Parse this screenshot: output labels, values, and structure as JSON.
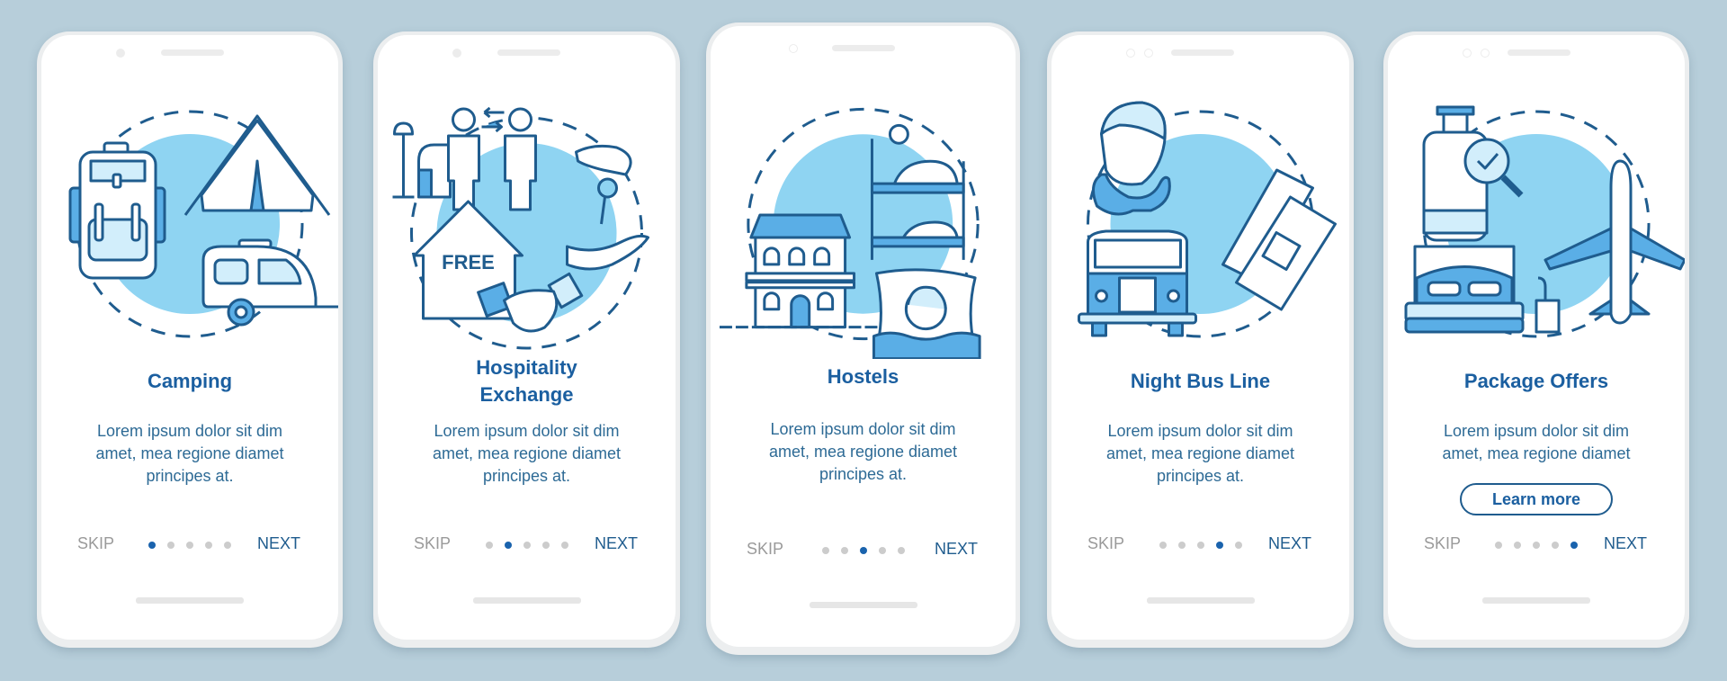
{
  "colors": {
    "background": "#b7ceda",
    "accent_dark": "#1b5fa0",
    "accent_light": "#8fd4f2",
    "dot_active": "#1a63ad",
    "dot_inactive": "#cccccc",
    "skip_text": "#9a9a9a"
  },
  "screens": [
    {
      "title": "Camping",
      "description": "Lorem ipsum dolor sit dim amet, mea regione diamet principes at.",
      "illustration": [
        "backpack-icon",
        "tent-icon",
        "camper-trailer-icon"
      ],
      "skip_label": "SKIP",
      "next_label": "NEXT",
      "page_index": 1,
      "page_count": 5
    },
    {
      "title": "Hospitality Exchange",
      "description": "Lorem ipsum dolor sit dim amet, mea regione diamet principes at.",
      "illustration": [
        "people-exchange-icon",
        "armchair-lamp-icon",
        "key-handover-icon",
        "free-house-icon",
        "handshake-icon"
      ],
      "illustration_text": "FREE",
      "skip_label": "SKIP",
      "next_label": "NEXT",
      "page_index": 2,
      "page_count": 5
    },
    {
      "title": "Hostels",
      "description": "Lorem ipsum dolor sit dim amet, mea regione diamet principes at.",
      "illustration": [
        "hostel-building-icon",
        "bunk-bed-icon",
        "sleeping-woman-icon"
      ],
      "skip_label": "SKIP",
      "next_label": "NEXT",
      "page_index": 3,
      "page_count": 5
    },
    {
      "title": "Night Bus Line",
      "description": "Lorem ipsum dolor sit dim amet, mea regione diamet principes at.",
      "illustration": [
        "sleeping-man-neck-pillow-icon",
        "bus-icon",
        "bus-tickets-icon"
      ],
      "skip_label": "SKIP",
      "next_label": "NEXT",
      "page_index": 4,
      "page_count": 5
    },
    {
      "title": "Package Offers",
      "description": "Lorem ipsum dolor sit dim amet, mea regione diamet",
      "illustration": [
        "luggage-check-icon",
        "airplane-icon",
        "hotel-bed-icon"
      ],
      "button_label": "Learn more",
      "skip_label": "SKIP",
      "next_label": "NEXT",
      "page_index": 5,
      "page_count": 5
    }
  ]
}
